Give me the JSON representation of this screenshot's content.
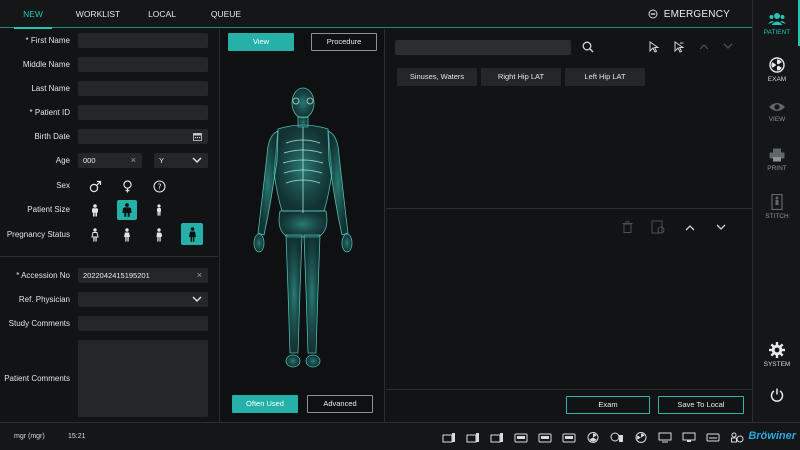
{
  "tabs": [
    "NEW",
    "WORKLIST",
    "LOCAL",
    "QUEUE"
  ],
  "emergency_label": "EMERGENCY",
  "form": {
    "first_name": "* First Name",
    "middle_name": "Middle Name",
    "last_name": "Last Name",
    "patient_id": "* Patient ID",
    "birth_date": "Birth Date",
    "age": "Age",
    "age_value": "000",
    "age_unit": "Y",
    "sex": "Sex",
    "patient_size": "Patient Size",
    "pregnancy_status": "Pregnancy Status",
    "accession_no": "* Accession No",
    "accession_value": "2022042415195201",
    "ref_physician": "Ref. Physician",
    "study_comments": "Study Comments",
    "patient_comments": "Patient Comments"
  },
  "center": {
    "view_label": "View",
    "procedure_label": "Procedure",
    "often_used_label": "Often Used",
    "advanced_label": "Advanced"
  },
  "procedures": [
    "Sinuses, Waters",
    "Right Hip LAT",
    "Left Hip LAT"
  ],
  "actions": {
    "exam_label": "Exam",
    "save_label": "Save To Local"
  },
  "nav": [
    "PATIENT",
    "EXAM",
    "VIEW",
    "PRINT",
    "STITCH",
    "SYSTEM"
  ],
  "status": {
    "user": "mgr (mgr)",
    "time": "15:21",
    "brand": "Bröwiner"
  },
  "colors": {
    "accent": "#25b1a7",
    "background": "#101214",
    "field": "#24272a"
  }
}
